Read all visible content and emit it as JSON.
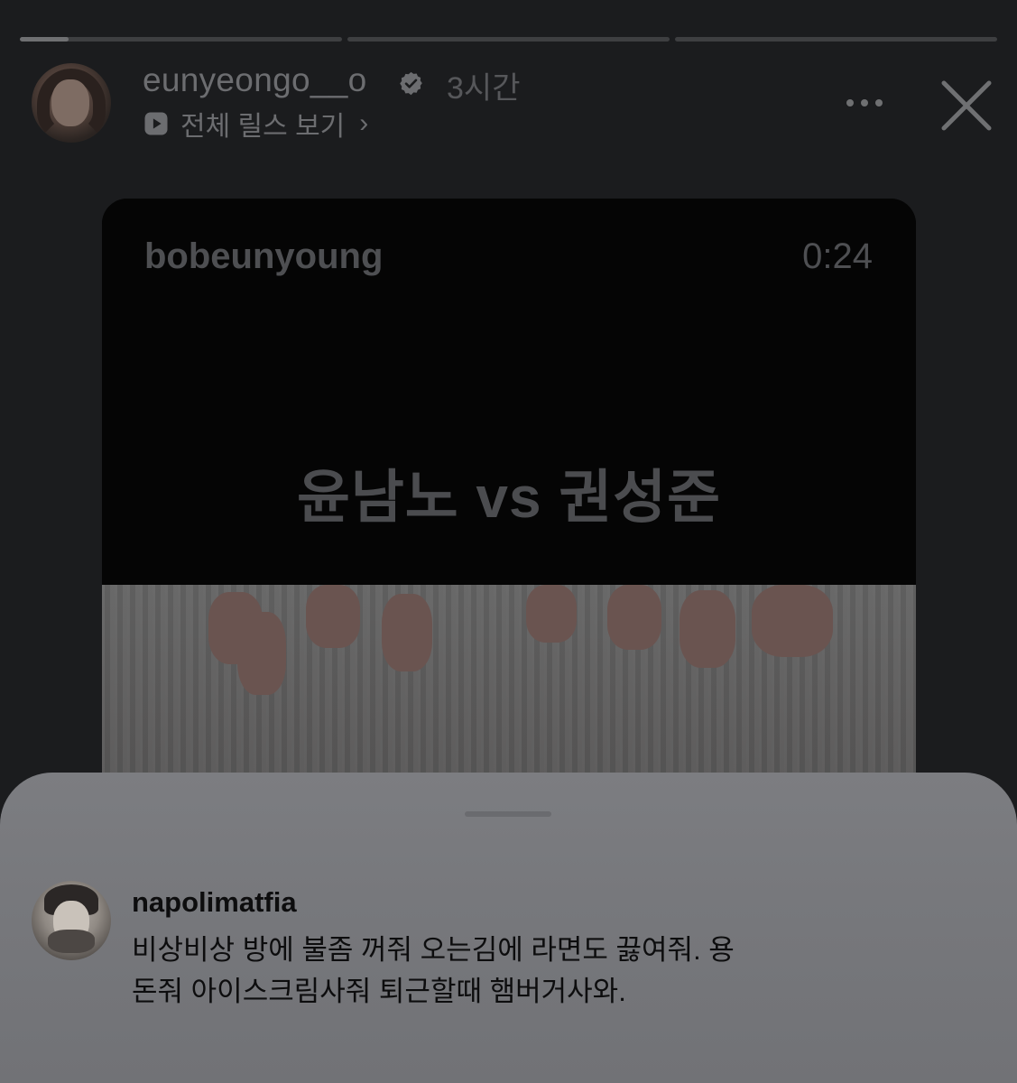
{
  "story": {
    "progress": [
      {
        "fill_fraction": 0.15
      },
      {
        "fill_fraction": 0
      },
      {
        "fill_fraction": 0
      }
    ],
    "header": {
      "username": "eunyeongo__o",
      "verified": true,
      "time_ago": "3시간",
      "reels_link_label": "전체 릴스 보기",
      "reels_link_chevron": "›"
    }
  },
  "reel": {
    "author": "bobeunyoung",
    "duration": "0:24",
    "title": "윤남노 vs 권성준"
  },
  "comment_sheet": {
    "comment": {
      "username": "napolimatfia",
      "lines": [
        "비상비상 방에 불좀 꺼줘 오는김에 라면도 끓여줘. 용",
        "돈줘 아이스크림사줘 퇴근할때 햄버거사와."
      ]
    }
  },
  "icons": {
    "verified": "verified-badge-icon",
    "reels": "reels-play-icon",
    "more": "more-dots-icon",
    "close": "close-icon"
  },
  "colors": {
    "background": "#1b1c1e",
    "sheet": "#77787c",
    "muted_text": "#6c6d70",
    "comment_text": "#0d0d0e"
  }
}
